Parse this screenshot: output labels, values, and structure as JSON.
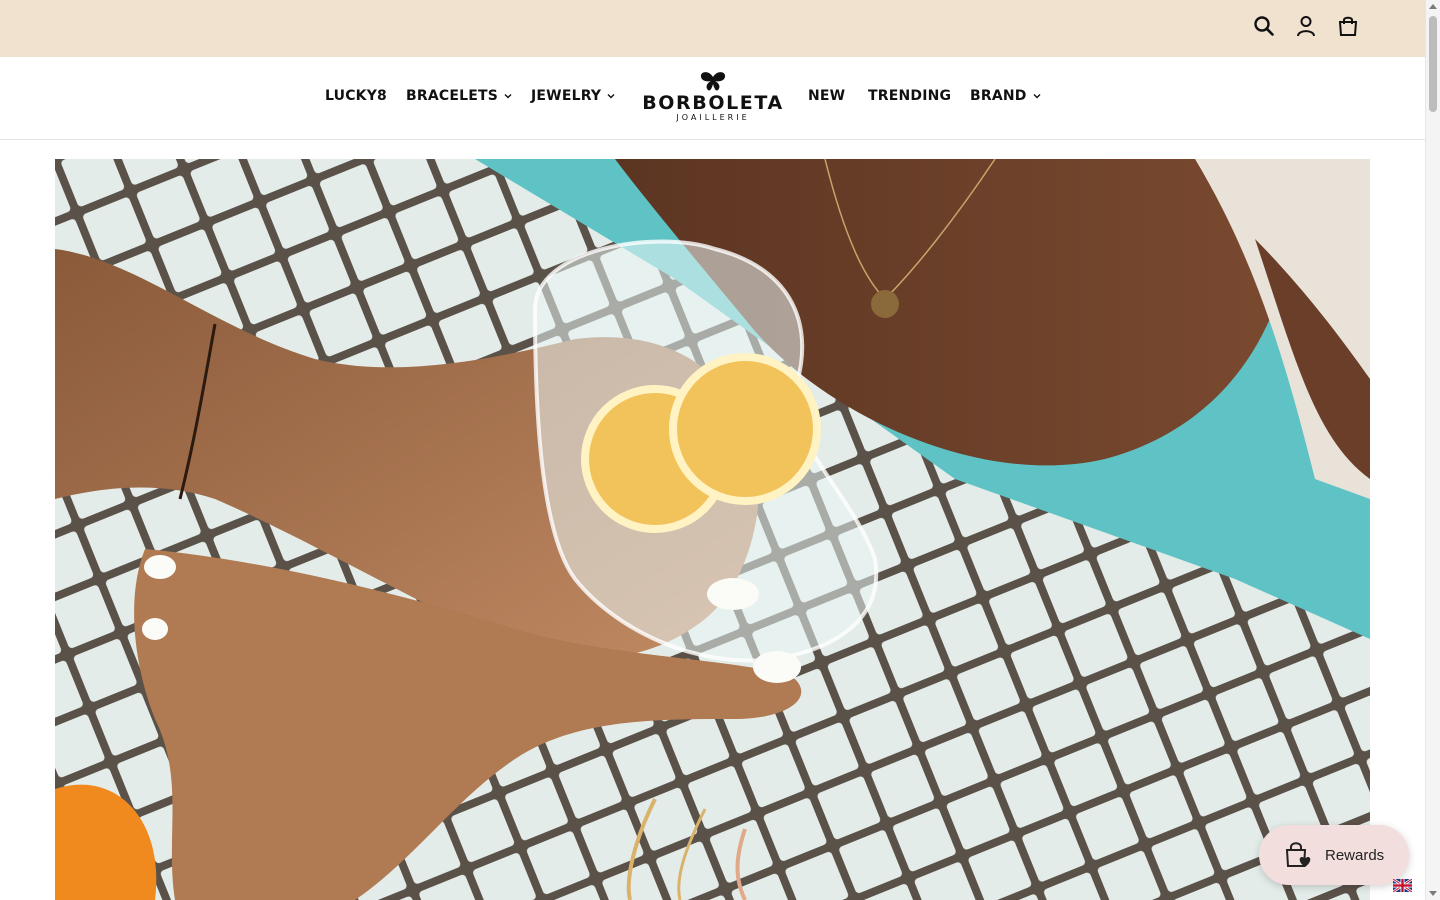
{
  "header": {
    "icons": [
      "search-icon",
      "account-icon",
      "cart-icon"
    ],
    "background": "#f1e1cf"
  },
  "nav": {
    "items": [
      {
        "label": "LUCKY8",
        "dropdown": false
      },
      {
        "label": "BRACELETS",
        "dropdown": true
      },
      {
        "label": "JEWELRY",
        "dropdown": true
      },
      {
        "label": "NEW",
        "dropdown": false
      },
      {
        "label": "TRENDING",
        "dropdown": false
      },
      {
        "label": "BRAND",
        "dropdown": true
      }
    ]
  },
  "logo": {
    "name": "BORBOLETA",
    "subtitle": "JOAILLERIE",
    "icon": "butterfly-icon"
  },
  "hero": {
    "image": "hero-photo"
  },
  "rewards": {
    "label": "Rewards",
    "icon": "shopping-bag-heart-icon",
    "background": "#f3dede"
  },
  "language": {
    "icon": "uk-flag-icon"
  }
}
